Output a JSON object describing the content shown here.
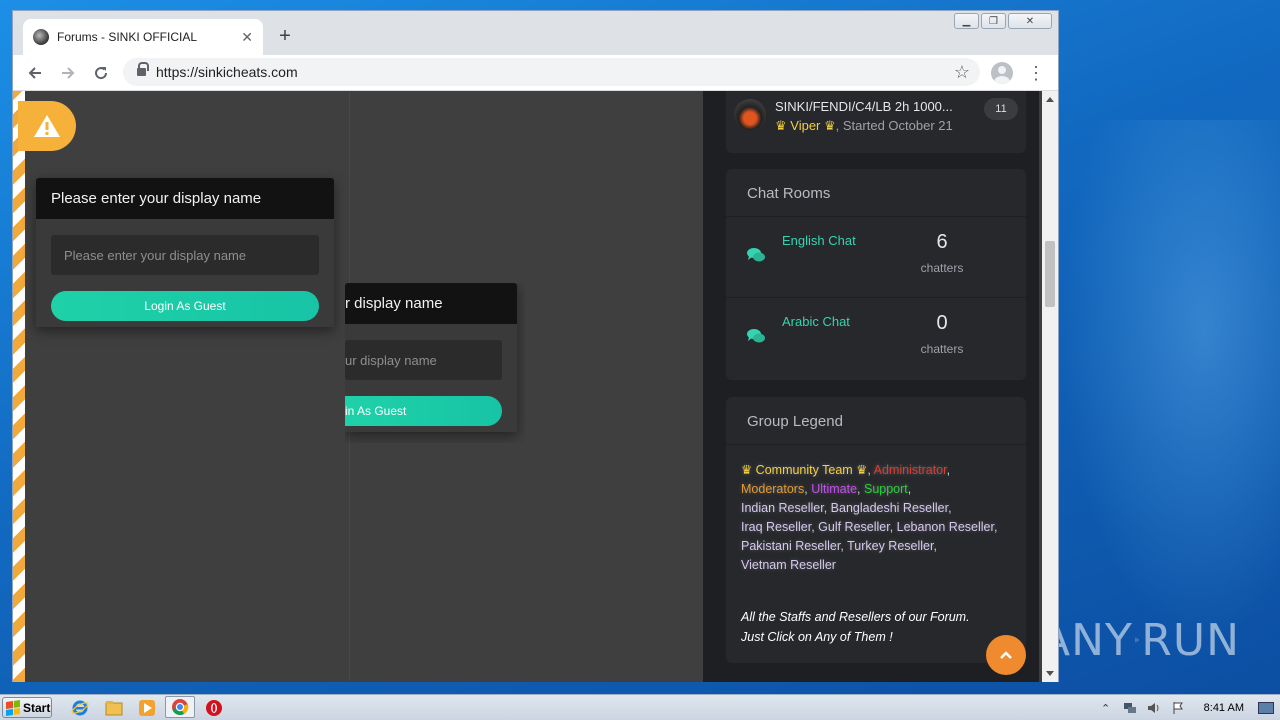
{
  "browser": {
    "tab_title": "Forums - SINKI OFFICIAL",
    "url": "https://sinkicheats.com"
  },
  "guest_login": {
    "title": "Please enter your display name",
    "placeholder": "Please enter your display name",
    "button_label": "Login As Guest",
    "ghost_title": "r display name",
    "ghost_placeholder": "ur display name",
    "ghost_button": "in As Guest"
  },
  "topic": {
    "title": "SINKI/FENDI/C4/LB 2h 1000...",
    "author": "♛ Viper ♛",
    "started": ", Started October 21",
    "reply_count": "11"
  },
  "chat_rooms": {
    "heading": "Chat Rooms",
    "rooms": [
      {
        "name": "English Chat",
        "count": "6",
        "label": "chatters"
      },
      {
        "name": "Arabic Chat",
        "count": "0",
        "label": "chatters"
      }
    ]
  },
  "group_legend": {
    "heading": "Group Legend",
    "groups": [
      {
        "name": "♛ Community Team ♛",
        "color": "#f4d03f"
      },
      {
        "name": "Administrator",
        "color": "#e03b2f"
      },
      {
        "name": "Moderators",
        "color": "#e59a2f"
      },
      {
        "name": "Ultimate",
        "color": "#c54cf0"
      },
      {
        "name": "Support",
        "color": "#27d13b"
      },
      {
        "name": "Indian Reseller",
        "color": "#d7c8ee"
      },
      {
        "name": "Bangladeshi Reseller",
        "color": "#d7c8ee"
      },
      {
        "name": "Iraq Reseller",
        "color": "#d7c8ee"
      },
      {
        "name": "Gulf Reseller",
        "color": "#d7c8ee"
      },
      {
        "name": "Lebanon Reseller",
        "color": "#d7c8ee"
      },
      {
        "name": "Pakistani Reseller",
        "color": "#d7c8ee"
      },
      {
        "name": "Turkey Reseller",
        "color": "#d7c8ee"
      },
      {
        "name": "Vietnam Reseller",
        "color": "#d7c8ee"
      }
    ],
    "note_line1": "All the Staffs and Resellers of our Forum.",
    "note_line2": "Just Click on Any of Them !"
  },
  "watermark": {
    "left": "ANY",
    "right": "RUN"
  },
  "taskbar": {
    "start_label": "Start",
    "clock": "8:41 AM"
  }
}
